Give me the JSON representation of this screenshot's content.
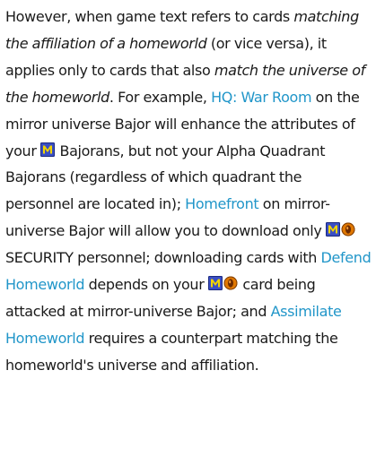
{
  "paragraph": {
    "t1": "However, when game text refers to cards ",
    "em1": "matching the affiliation of a homeworld",
    "t2": " (or vice versa), it applies only to cards that also ",
    "em2": "match the universe of the homeworld",
    "t3": ". For example, ",
    "link_hq_war_room": "HQ: War Room",
    "t4": " on the mirror universe Bajor will enhance the attributes of your ",
    "t5": " Bajorans, but not your Alpha Quadrant Bajorans (regardless of which quadrant the personnel are located in); ",
    "link_homefront": "Homefront",
    "t6": " on mirror-universe Bajor will allow you to download only ",
    "t7": " SECURITY personnel; downloading cards with ",
    "link_defend_homeworld": "Defend Homeworld",
    "t8": " depends on your ",
    "t9": " card being attacked at mirror-universe Bajor; and ",
    "link_assimilate_homeworld": "Assimilate Homeworld",
    "t10": " requires a counterpart matching the homeworld's universe and affiliation."
  },
  "icons": {
    "mirror_icon": "mirror-universe-icon",
    "bajoran_icon": "bajoran-affiliation-icon"
  },
  "colors": {
    "text": "#1a1a1a",
    "link": "#2196c9",
    "mirror_icon_bg": "#3a4fc4",
    "mirror_icon_letter": "#f2d400",
    "bajoran_icon_bg": "#e07800",
    "bajoran_icon_inner": "#6b2a00"
  }
}
